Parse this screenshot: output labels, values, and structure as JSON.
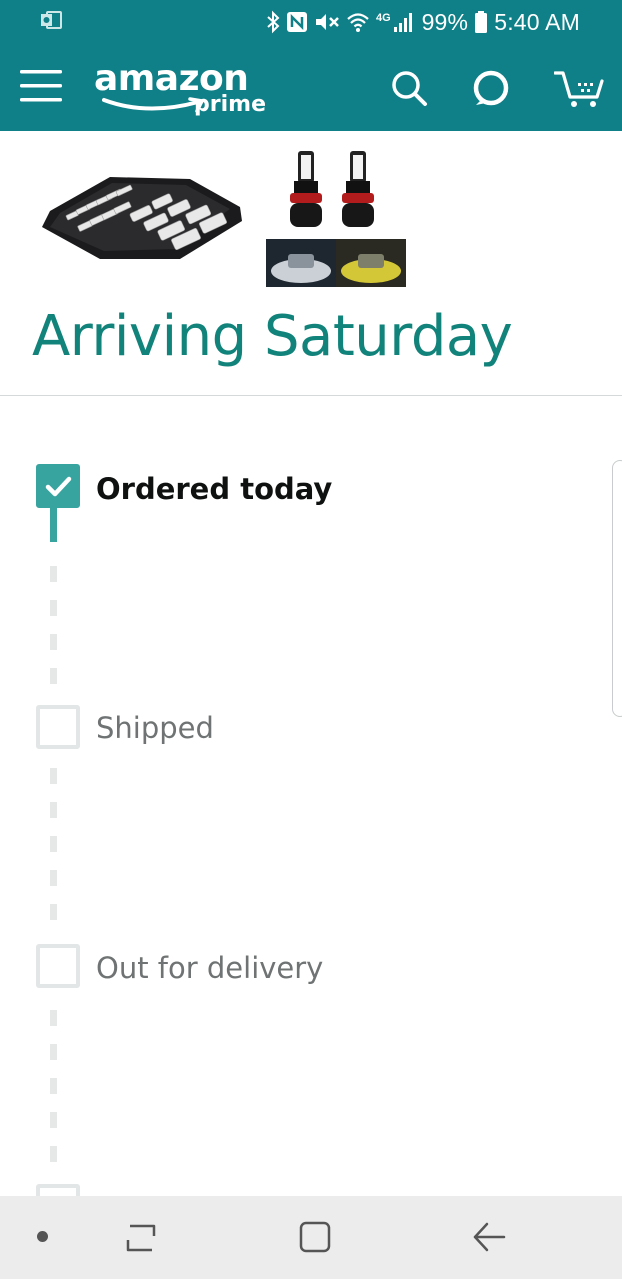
{
  "status_bar": {
    "battery": "99%",
    "time": "5:40 AM",
    "network": "4G",
    "icons": [
      "outlook-icon",
      "bluetooth-icon",
      "nfc-icon",
      "mute-icon",
      "wifi-icon",
      "signal-icon",
      "battery-icon"
    ]
  },
  "header": {
    "logo_word": "amazon",
    "logo_sub": "prime",
    "icons": [
      "menu-icon",
      "search-icon",
      "alexa-icon",
      "cart-icon"
    ]
  },
  "colors": {
    "header_bg": "#108088",
    "accent": "#37a4a0",
    "heading": "#11837a"
  },
  "order": {
    "products": [
      "hex-bit-socket-set",
      "led-fog-light-bulbs"
    ],
    "arrival": "Arriving Saturday",
    "steps": [
      {
        "label": "Ordered today",
        "done": true
      },
      {
        "label": "Shipped",
        "done": false
      },
      {
        "label": "Out for delivery",
        "done": false
      }
    ]
  },
  "navbar": {
    "icons": [
      "dot-icon",
      "recent-apps-icon",
      "home-icon",
      "back-icon"
    ]
  }
}
